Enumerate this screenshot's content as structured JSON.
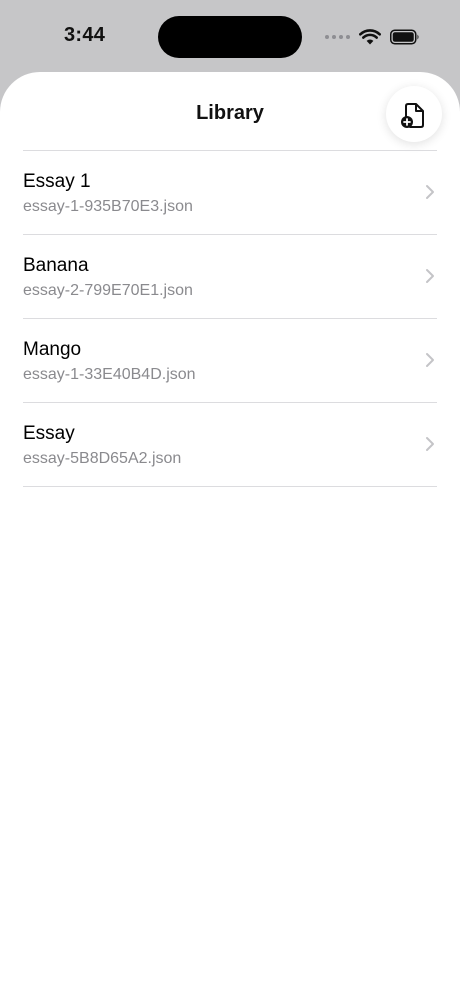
{
  "status_bar": {
    "time": "3:44"
  },
  "header": {
    "title": "Library",
    "add_button_icon": "add-document-icon"
  },
  "files": [
    {
      "name": "Essay 1",
      "filename": "essay-1-935B70E3.json"
    },
    {
      "name": "Banana",
      "filename": "essay-2-799E70E1.json"
    },
    {
      "name": "Mango",
      "filename": "essay-1-33E40B4D.json"
    },
    {
      "name": "Essay",
      "filename": "essay-5B8D65A2.json"
    }
  ],
  "colors": {
    "status_area_bg": "#c6c6c8",
    "sheet_bg": "#ffffff",
    "secondary_text": "#8a8a8e",
    "separator": "#dcdcdf",
    "chevron": "#c4c4c7"
  }
}
